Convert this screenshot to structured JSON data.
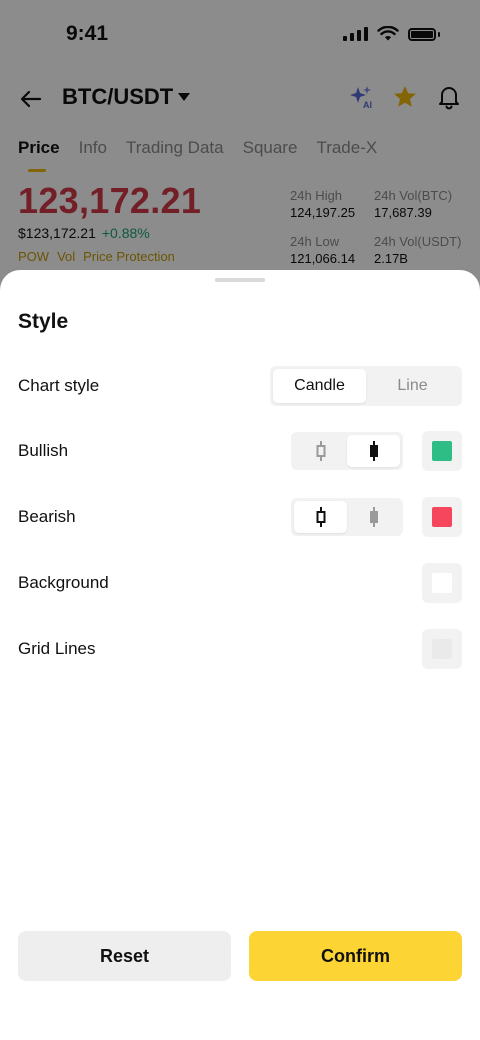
{
  "status_bar": {
    "time": "9:41"
  },
  "header": {
    "title": "BTC/USDT"
  },
  "tabs": [
    {
      "label": "Price"
    },
    {
      "label": "Info"
    },
    {
      "label": "Trading Data"
    },
    {
      "label": "Square"
    },
    {
      "label": "Trade-X"
    }
  ],
  "ticker": {
    "last_price": "123,172.21",
    "usd_price": "$123,172.21",
    "change": "+0.88%",
    "tags": [
      "POW",
      "Vol",
      "Price Protection"
    ],
    "stats": [
      {
        "label": "24h High",
        "value": "124,197.25"
      },
      {
        "label": "24h Vol(BTC)",
        "value": "17,687.39"
      },
      {
        "label": "24h Low",
        "value": "121,066.14"
      },
      {
        "label": "24h Vol(USDT)",
        "value": "2.17B"
      }
    ]
  },
  "sheet": {
    "title": "Style",
    "chart_style": {
      "label": "Chart style",
      "options": [
        "Candle",
        "Line"
      ],
      "selected": "Candle"
    },
    "bullish": {
      "label": "Bullish",
      "color": "#2ebd85",
      "selected_candle": "filled"
    },
    "bearish": {
      "label": "Bearish",
      "color": "#f6465d",
      "selected_candle": "hollow"
    },
    "background": {
      "label": "Background",
      "color": "#ffffff"
    },
    "grid_lines": {
      "label": "Grid Lines",
      "color": "#eeeeee"
    },
    "reset_label": "Reset",
    "confirm_label": "Confirm"
  },
  "icons": [
    "back-arrow-icon",
    "caret-down-icon",
    "ai-sparkle-icon",
    "star-icon",
    "bell-icon",
    "candle-hollow-icon",
    "candle-filled-icon"
  ],
  "colors": {
    "accent": "#fcd535",
    "up": "#2ebd85",
    "down": "#f6465d"
  }
}
